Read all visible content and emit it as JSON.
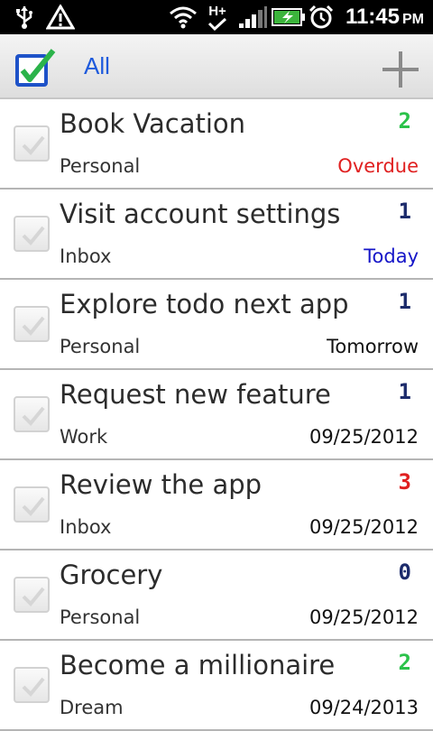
{
  "status_bar": {
    "time": "11:45",
    "ampm": "PM",
    "icons": [
      "usb-icon",
      "warning-icon",
      "wifi-icon",
      "hplus-network-icon",
      "signal-icon",
      "battery-charging-icon",
      "alarm-icon"
    ],
    "network_label": "H+"
  },
  "action_bar": {
    "filter_label": "All",
    "logo_icon": "checkbox-logo-icon",
    "add_icon": "plus-icon"
  },
  "colors": {
    "accent_blue": "#1e5adc",
    "overdue_red": "#e02020",
    "today_blue": "#1515c8",
    "priority_green": "#2bc24a",
    "priority_navy": "#1c2b6b",
    "priority_red": "#e02020"
  },
  "tasks": [
    {
      "title": "Book Vacation",
      "list": "Personal",
      "due": "Overdue",
      "due_color": "#e02020",
      "priority": "2",
      "priority_color": "#2bc24a"
    },
    {
      "title": "Visit account settings",
      "list": "Inbox",
      "due": "Today",
      "due_color": "#1515c8",
      "priority": "1",
      "priority_color": "#1c2b6b"
    },
    {
      "title": "Explore todo next app",
      "list": "Personal",
      "due": "Tomorrow",
      "due_color": "#111111",
      "priority": "1",
      "priority_color": "#1c2b6b"
    },
    {
      "title": "Request new feature",
      "list": "Work",
      "due": "09/25/2012",
      "due_color": "#111111",
      "priority": "1",
      "priority_color": "#1c2b6b"
    },
    {
      "title": "Review the app",
      "list": "Inbox",
      "due": "09/25/2012",
      "due_color": "#111111",
      "priority": "3",
      "priority_color": "#e02020"
    },
    {
      "title": "Grocery",
      "list": "Personal",
      "due": "09/25/2012",
      "due_color": "#111111",
      "priority": "0",
      "priority_color": "#1c2b6b"
    },
    {
      "title": "Become a millionaire",
      "list": "Dream",
      "due": "09/24/2013",
      "due_color": "#111111",
      "priority": "2",
      "priority_color": "#2bc24a"
    }
  ]
}
